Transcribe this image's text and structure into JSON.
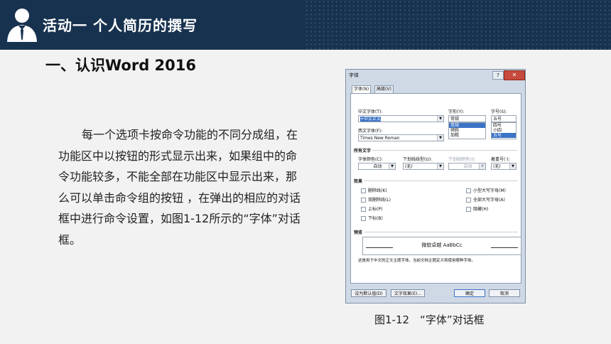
{
  "slide": {
    "title": "活动一  个人简历的撰写",
    "heading": "一、认识Word 2016",
    "body": "每一个选项卡按命令功能的不同分成组，在功能区中以按钮的形式显示出来，如果组中的命令功能较多，不能全部在功能区中显示出来，那么可以单击命令组的按钮 ，在弹出的相应的对话框中进行命令设置，如图1-12所示的“字体”对话框。",
    "caption": "图1-12　“字体”对话框"
  },
  "dialog": {
    "title": "字体",
    "help": "?",
    "close": "✕",
    "tabs": [
      "字体(N)",
      "高级(V)"
    ],
    "chinese_font_label": "中文字体(T):",
    "chinese_font_value": "+中文正文",
    "style_label": "字形(Y):",
    "style_value": "常规",
    "style_options": [
      "常规",
      "倾斜",
      "加粗"
    ],
    "size_label": "字号(S):",
    "size_value": "五号",
    "size_options": [
      "四号",
      "小四",
      "五号"
    ],
    "western_font_label": "西文字体(F):",
    "western_font_value": "Times New Roman",
    "all_text_label": "所有文字",
    "font_color_label": "字体颜色(C):",
    "font_color_value": "自动",
    "underline_label": "下划线线型(U):",
    "underline_value": "(无)",
    "underline_color_label": "下划线颜色(I):",
    "underline_color_value": "自动",
    "emphasis_label": "着重号(·):",
    "emphasis_value": "(无)",
    "effects_label": "效果",
    "effects_left": [
      "删除线(K)",
      "双删除线(L)",
      "上标(P)",
      "下标(B)"
    ],
    "effects_right": [
      "小型大写字母(M)",
      "全部大写字母(A)",
      "隐藏(H)"
    ],
    "preview_label": "预览",
    "preview_text": "微软卓越 AaBbCc",
    "preview_note": "这是用于中文的正文主题字体。当前文档主题定义将使用哪种字体。",
    "btn_default": "设为默认值(D)",
    "btn_effects": "文字效果(E)...",
    "btn_ok": "确定",
    "btn_cancel": "取消"
  }
}
